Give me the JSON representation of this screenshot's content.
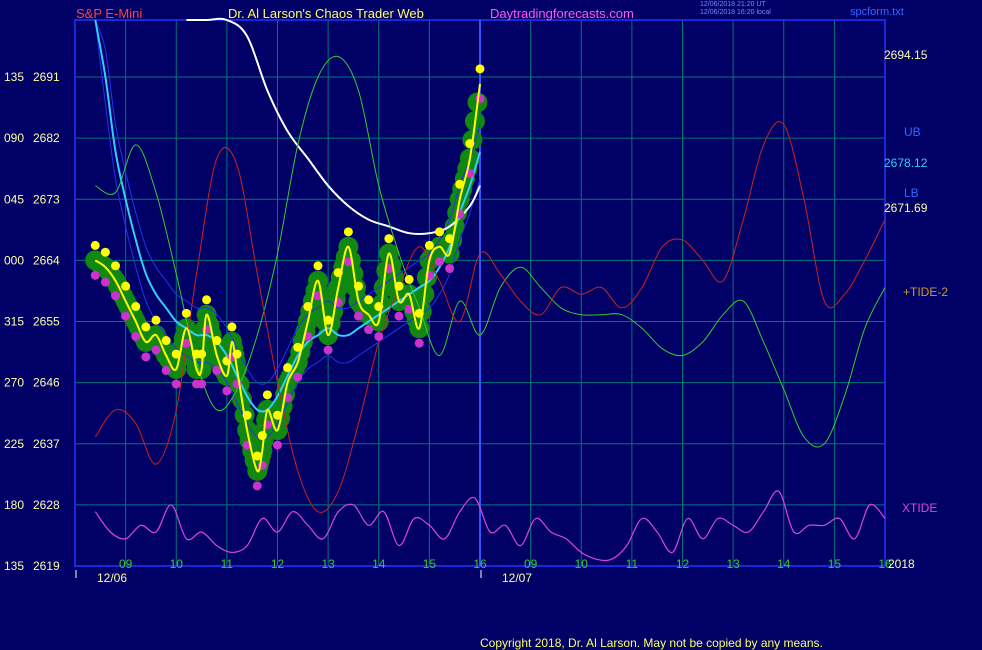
{
  "header": {
    "symbol": "S&P E-Mini",
    "site_title": "Dr. Al Larson's Chaos Trader Web",
    "site_url": "Daytradingforecasts.com",
    "timestamp_ut": "12/06/2018 21:20 UT",
    "timestamp_local": "12/06/2018 16:20 local",
    "file": "spcform.txt"
  },
  "footer": {
    "copyright": "Copyright 2018, Dr. Al Larson. May not be copied by any means."
  },
  "colors": {
    "background": "#000066",
    "grid": "#007777",
    "frame": "#2233ff",
    "price": "#ffff00",
    "dots_high": "#ffff00",
    "dots_low": "#cc33cc",
    "halo": "#118811",
    "ma_white": "#ffffff",
    "ma_cyan": "#33ccff",
    "bands": "#2233ee",
    "green_cycle": "#33cc33",
    "red_cycle": "#cc2222",
    "xtide": "#dd44dd"
  },
  "chart_data": {
    "type": "line",
    "title": "S&P E-Mini",
    "y_left_angles": [
      "135",
      "090",
      "045",
      "000",
      "315",
      "270",
      "225",
      "180",
      "135"
    ],
    "y_left_prices": [
      2691,
      2682,
      2673,
      2664,
      2655,
      2646,
      2637,
      2628,
      2619
    ],
    "ylim": [
      2619,
      2695
    ],
    "x_hour_labels": [
      "09",
      "10",
      "11",
      "12",
      "13",
      "14",
      "15",
      "16",
      "09",
      "10",
      "11",
      "12",
      "13",
      "14",
      "15",
      "16"
    ],
    "date_labels": [
      "12/06",
      "12/07"
    ],
    "year_label": "2018",
    "right_labels": {
      "last_price": "2694.15",
      "ub_label": "UB",
      "ub_value": "2678.12",
      "lb_label": "LB",
      "lb_value": "2671.69",
      "tide_label": "+TIDE-2",
      "xtide_label": "XTIDE"
    },
    "price_x": [
      0.4,
      0.6,
      0.8,
      1.0,
      1.2,
      1.4,
      1.6,
      1.8,
      2.0,
      2.2,
      2.4,
      2.5,
      2.6,
      2.8,
      3.0,
      3.1,
      3.2,
      3.4,
      3.6,
      3.7,
      3.8,
      4.0,
      4.2,
      4.4,
      4.6,
      4.8,
      5.0,
      5.2,
      5.4,
      5.6,
      5.8,
      6.0,
      6.2,
      6.4,
      6.6,
      6.8,
      7.0,
      7.2,
      7.4,
      7.6,
      7.8,
      8.0
    ],
    "price_y": [
      2664,
      2663,
      2661,
      2658,
      2655,
      2652,
      2653,
      2650,
      2648,
      2654,
      2648,
      2648,
      2656,
      2650,
      2647,
      2652,
      2648,
      2639,
      2633,
      2636,
      2642,
      2639,
      2646,
      2649,
      2655,
      2661,
      2653,
      2660,
      2666,
      2658,
      2656,
      2655,
      2665,
      2658,
      2659,
      2654,
      2664,
      2666,
      2665,
      2673,
      2679,
      2690
    ],
    "series": [
      {
        "name": "white",
        "x": [
          2.2,
          2.6,
          3.0,
          3.4,
          3.8,
          4.2,
          4.6,
          5.0,
          5.4,
          5.8,
          6.2,
          6.6,
          7.0,
          7.4,
          7.8,
          8.0
        ],
        "y": [
          2726,
          2715,
          2705,
          2697,
          2689,
          2683,
          2679,
          2675,
          2672,
          2670,
          2669,
          2668,
          2668,
          2669,
          2672,
          2675
        ]
      },
      {
        "name": "cyan",
        "x": [
          0.4,
          0.6,
          0.8,
          1.0,
          1.2,
          1.4,
          1.6,
          1.8,
          2.0,
          2.2,
          2.4,
          2.6,
          2.8,
          3.0,
          3.2,
          3.4,
          3.6,
          3.8,
          4.0,
          4.2,
          4.4,
          4.6,
          4.8,
          5.0,
          5.2,
          5.4,
          5.6,
          5.8,
          6.0,
          6.2,
          6.4,
          6.6,
          6.8,
          7.0,
          7.2,
          7.4,
          7.6,
          7.8,
          8.0
        ],
        "y": [
          2711,
          2691,
          2680,
          2673,
          2667,
          2662,
          2659,
          2657,
          2655,
          2654,
          2653,
          2653,
          2652,
          2650,
          2647,
          2644,
          2642,
          2642,
          2644,
          2647,
          2650,
          2652,
          2653,
          2654,
          2653,
          2653,
          2654,
          2655,
          2656,
          2657,
          2658,
          2659,
          2660,
          2661,
          2663,
          2666,
          2671,
          2675,
          2680
        ]
      },
      {
        "name": "green_cycle",
        "x": [
          0.4,
          0.8,
          1.2,
          1.6,
          2.0,
          2.4,
          2.8,
          3.2,
          3.6,
          4.0,
          4.4,
          4.8,
          5.2,
          5.6,
          6.0,
          6.4,
          6.8,
          7.2,
          7.6,
          8.0,
          8.4,
          8.8,
          9.2,
          9.6,
          10.0,
          10.4,
          10.8,
          11.2,
          11.6,
          12.0,
          12.4,
          12.8,
          13.2,
          13.6,
          14.0,
          14.4,
          14.8,
          15.2,
          15.6,
          16.0
        ],
        "y": [
          2675,
          2674,
          2681,
          2674,
          2662,
          2649,
          2642,
          2645,
          2653,
          2665,
          2681,
          2691,
          2694,
          2689,
          2675,
          2665,
          2657,
          2650,
          2658,
          2653,
          2660,
          2663,
          2660,
          2657,
          2656,
          2656,
          2656,
          2654,
          2651,
          2650,
          2652,
          2656,
          2658,
          2652,
          2645,
          2638,
          2637,
          2644,
          2654,
          2660
        ]
      },
      {
        "name": "red_cycle",
        "x": [
          0.4,
          0.8,
          1.2,
          1.6,
          2.0,
          2.4,
          2.8,
          3.2,
          3.6,
          4.0,
          4.4,
          4.8,
          5.2,
          5.6,
          6.0,
          6.4,
          6.8,
          7.2,
          7.6,
          8.0,
          8.4,
          8.8,
          9.2,
          9.6,
          10.0,
          10.4,
          10.8,
          11.2,
          11.6,
          12.0,
          12.4,
          12.8,
          13.2,
          13.6,
          14.0,
          14.4,
          14.8,
          15.2,
          15.6,
          16.0
        ],
        "y": [
          2638,
          2642,
          2640,
          2634,
          2642,
          2662,
          2679,
          2678,
          2662,
          2646,
          2633,
          2627,
          2630,
          2640,
          2652,
          2660,
          2666,
          2661,
          2655,
          2665,
          2662,
          2658,
          2656,
          2660,
          2659,
          2660,
          2657,
          2660,
          2666,
          2667,
          2664,
          2661,
          2670,
          2681,
          2684,
          2673,
          2658,
          2659,
          2664,
          2670
        ]
      },
      {
        "name": "xtide",
        "x": [
          0.4,
          0.7,
          1.0,
          1.3,
          1.6,
          1.9,
          2.2,
          2.5,
          2.8,
          3.1,
          3.4,
          3.7,
          4.0,
          4.3,
          4.6,
          4.9,
          5.2,
          5.5,
          5.8,
          6.1,
          6.4,
          6.7,
          7.0,
          7.3,
          7.6,
          7.9,
          8.2,
          8.5,
          8.8,
          9.1,
          9.4,
          9.7,
          10.0,
          10.3,
          10.6,
          10.9,
          11.2,
          11.5,
          11.8,
          12.1,
          12.4,
          12.7,
          13.0,
          13.3,
          13.6,
          13.9,
          14.2,
          14.5,
          14.8,
          15.1,
          15.4,
          15.7,
          16.0
        ],
        "y": [
          2627,
          2624,
          2623,
          2625,
          2624,
          2628,
          2623,
          2624,
          2622,
          2621,
          2622,
          2626,
          2624,
          2627,
          2625,
          2623,
          2627,
          2628,
          2625,
          2627,
          2622,
          2626,
          2625,
          2623,
          2627,
          2629,
          2624,
          2625,
          2622,
          2626,
          2624,
          2623,
          2621,
          2620,
          2620,
          2622,
          2626,
          2624,
          2621,
          2626,
          2623,
          2626,
          2625,
          2624,
          2627,
          2630,
          2624,
          2625,
          2625,
          2626,
          2623,
          2628,
          2626
        ]
      }
    ]
  }
}
